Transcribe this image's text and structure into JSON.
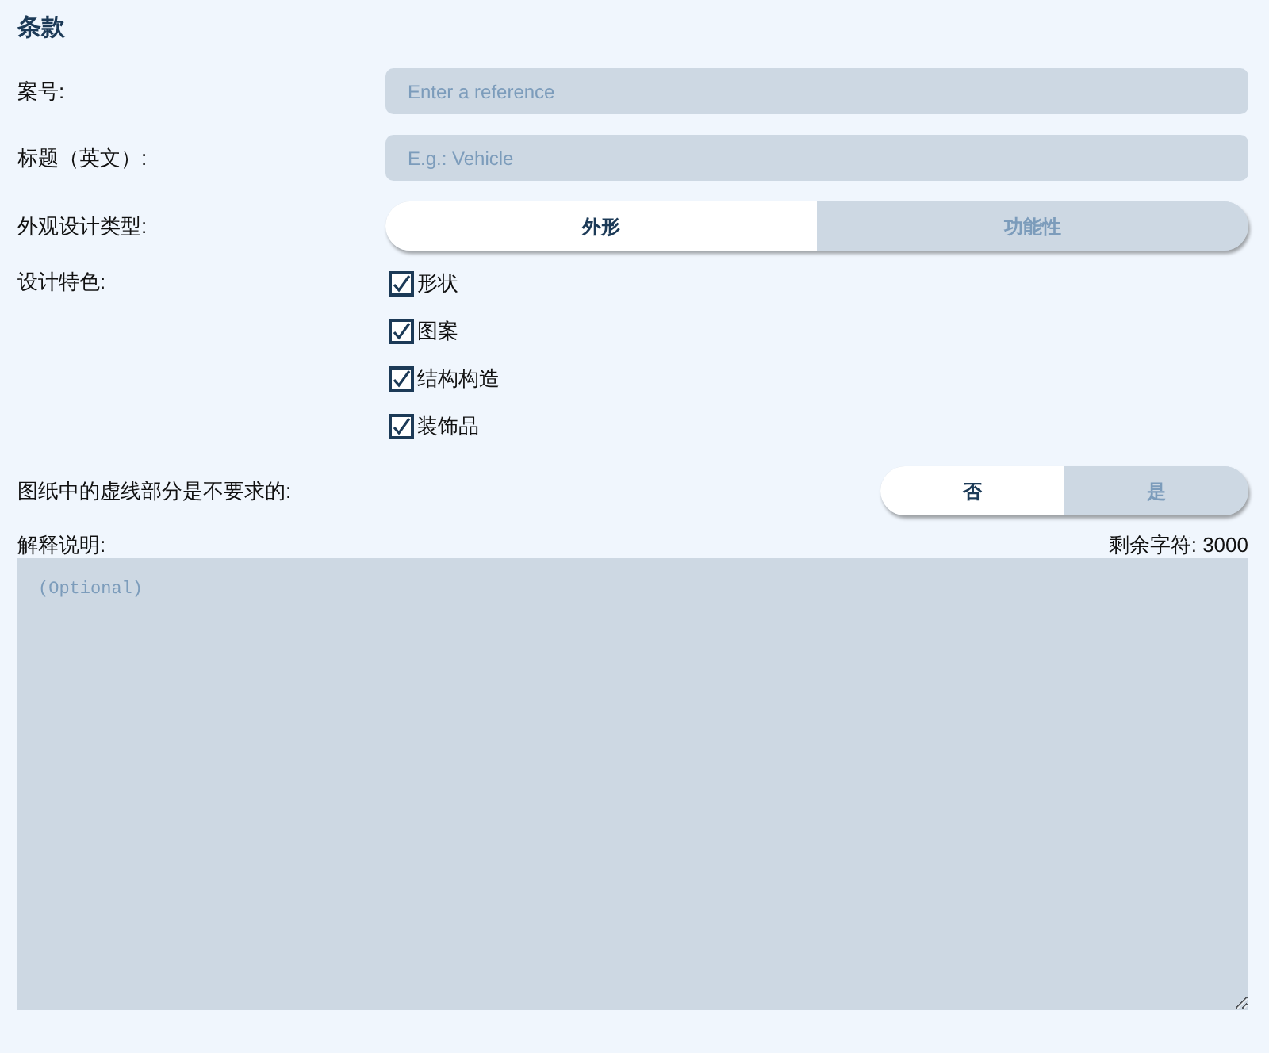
{
  "title": "条款",
  "reference": {
    "label": "案号:",
    "placeholder": "Enter a reference"
  },
  "title_en": {
    "label": "标题（英文）:",
    "placeholder": "E.g.: Vehicle"
  },
  "design_type": {
    "label": "外观设计类型:",
    "options": [
      {
        "label": "外形",
        "selected": true
      },
      {
        "label": "功能性",
        "selected": false
      }
    ]
  },
  "features": {
    "label": "设计特色:",
    "items": [
      {
        "label": "形状",
        "checked": true
      },
      {
        "label": "图案",
        "checked": true
      },
      {
        "label": "结构构造",
        "checked": true
      },
      {
        "label": "装饰品",
        "checked": true
      }
    ]
  },
  "dashed_lines": {
    "label": "图纸中的虚线部分是不要求的:",
    "options": [
      {
        "label": "否",
        "selected": true
      },
      {
        "label": "是",
        "selected": false
      }
    ]
  },
  "explanation": {
    "label": "解释说明:",
    "counter": "剩余字符: 3000",
    "placeholder": "(Optional)"
  }
}
